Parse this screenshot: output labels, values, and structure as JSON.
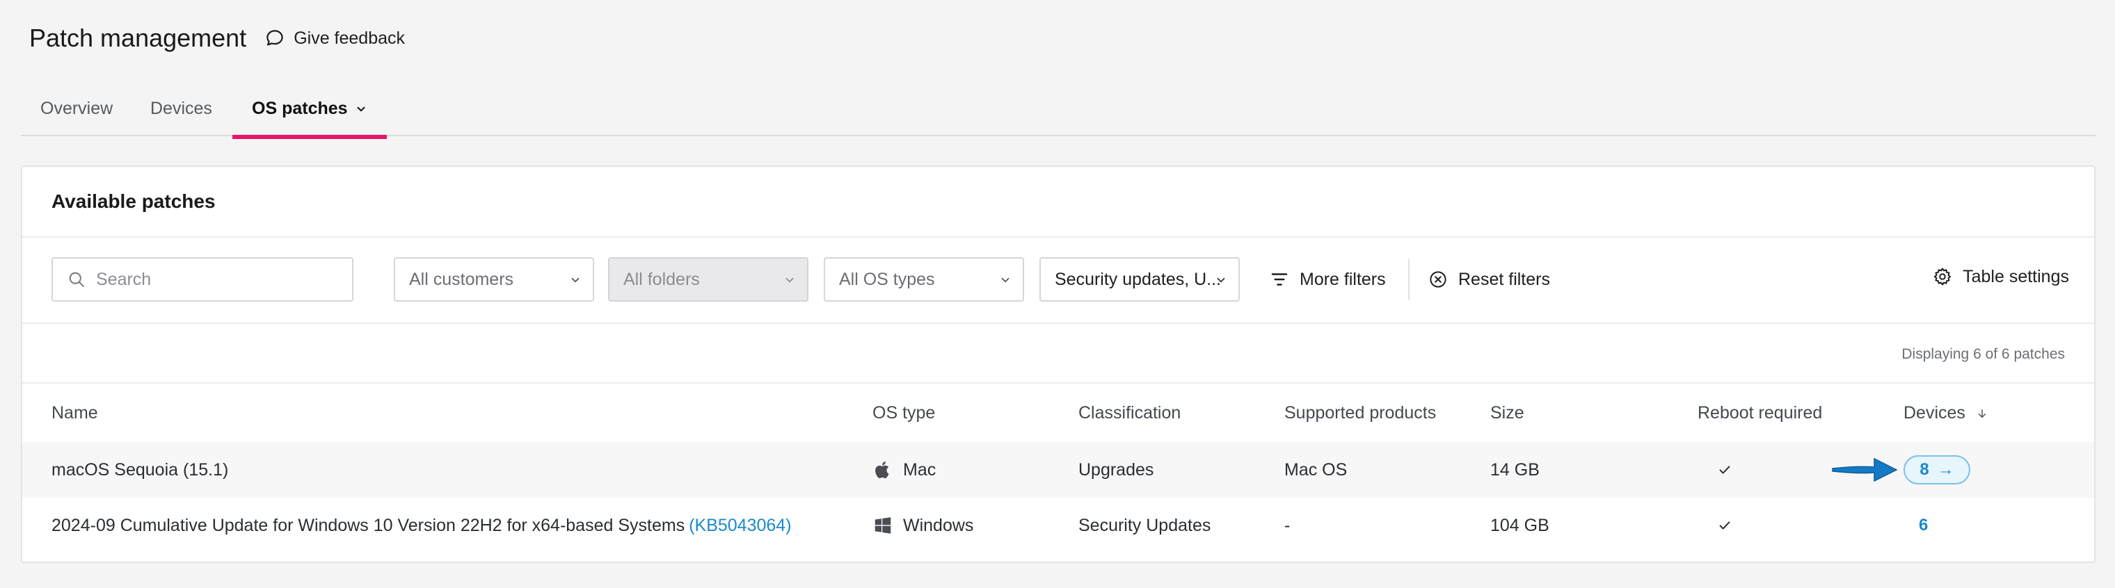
{
  "header": {
    "title": "Patch management",
    "feedback_label": "Give feedback"
  },
  "tabs": [
    {
      "label": "Overview",
      "active": false
    },
    {
      "label": "Devices",
      "active": false
    },
    {
      "label": "OS patches",
      "active": true
    }
  ],
  "card": {
    "title": "Available patches"
  },
  "filters": {
    "search_placeholder": "Search",
    "customers": "All customers",
    "folders": "All folders",
    "os_types": "All OS types",
    "classification": "Security updates, U...",
    "more_filters": "More filters",
    "reset_filters": "Reset filters",
    "table_settings": "Table settings"
  },
  "displaying_text": "Displaying 6 of 6 patches",
  "table": {
    "columns": [
      "Name",
      "OS type",
      "Classification",
      "Supported products",
      "Size",
      "Reboot required",
      "Devices"
    ],
    "rows": [
      {
        "name": "macOS Sequoia (15.1)",
        "name_link": "",
        "os_icon": "apple-icon",
        "os_type": "Mac",
        "classification": "Upgrades",
        "supported_products": "Mac OS",
        "size": "14 GB",
        "reboot_required": true,
        "devices": "8",
        "devices_arrow": "→"
      },
      {
        "name": "2024-09 Cumulative Update for Windows 10 Version 22H2 for x64-based Systems",
        "name_link": "(KB5043064)",
        "os_icon": "windows-icon",
        "os_type": "Windows",
        "classification": "Security Updates",
        "supported_products": "-",
        "size": "104 GB",
        "reboot_required": true,
        "devices": "6"
      }
    ]
  },
  "colors": {
    "accent_tab": "#e6156b",
    "link": "#1a8acb",
    "pointer_arrow": "#1479c4"
  }
}
